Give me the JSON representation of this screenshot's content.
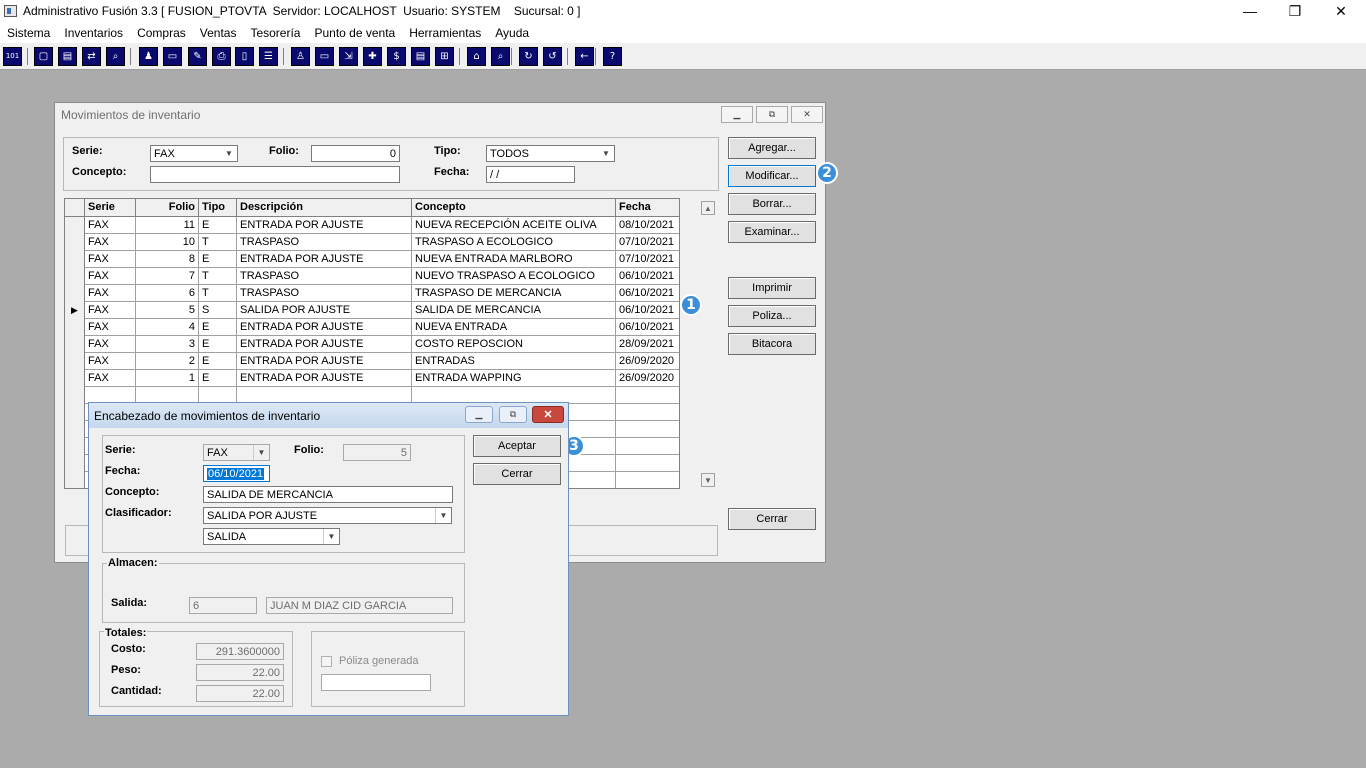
{
  "app": {
    "title": "Administrativo Fusión 3.3 [ FUSION_PTOVTA  Servidor: LOCALHOST  Usuario: SYSTEM    Sucursal: 0 ]",
    "minimize": "—",
    "restore": "❐",
    "close": "✕"
  },
  "menu": [
    "Sistema",
    "Inventarios",
    "Compras",
    "Ventas",
    "Tesorería",
    "Punto de venta",
    "Herramientas",
    "Ayuda"
  ],
  "toolbar": {
    "icons": [
      "calculator-icon",
      "copy-icon",
      "paste-icon",
      "swap-icon",
      "zoom-icon",
      "user-icon",
      "folder-icon",
      "edit-icon",
      "print-icon",
      "document-icon",
      "list-icon",
      "group-icon",
      "window-icon",
      "export-icon",
      "add-icon",
      "dollar-icon",
      "report-icon",
      "tree-icon",
      "home-icon",
      "search-icon",
      "refresh-icon",
      "undo-icon",
      "back-icon",
      "help-icon"
    ],
    "glyphs": [
      "101",
      "▢",
      "▤",
      "⇄",
      "⌕",
      "♟",
      "▭",
      "✎",
      "⎙",
      "▯",
      "☰",
      "♙",
      "▭",
      "⇲",
      "✚",
      "$",
      "▤",
      "⊞",
      "⌂",
      "⌕",
      "↻",
      "↺",
      "←",
      "?"
    ]
  },
  "main": {
    "title": "Movimientos de inventario",
    "filters": {
      "serie_label": "Serie:",
      "serie_value": "FAX",
      "folio_label": "Folio:",
      "folio_value": "0",
      "tipo_label": "Tipo:",
      "tipo_value": "TODOS",
      "concepto_label": "Concepto:",
      "concepto_value": "",
      "fecha_label": "Fecha:",
      "fecha_value": " / /"
    },
    "grid": {
      "headers": [
        "Serie",
        "Folio",
        "Tipo",
        "Descripción",
        "Concepto",
        "Fecha"
      ],
      "rows": [
        [
          "FAX",
          "11",
          "E",
          "ENTRADA POR AJUSTE",
          "NUEVA RECEPCIÓN ACEITE OLIVA",
          "08/10/2021"
        ],
        [
          "FAX",
          "10",
          "T",
          "TRASPASO",
          "TRASPASO A ECOLOGICO",
          "07/10/2021"
        ],
        [
          "FAX",
          "8",
          "E",
          "ENTRADA POR AJUSTE",
          "NUEVA ENTRADA MARLBORO",
          "07/10/2021"
        ],
        [
          "FAX",
          "7",
          "T",
          "TRASPASO",
          "NUEVO TRASPASO A ECOLOGICO",
          "06/10/2021"
        ],
        [
          "FAX",
          "6",
          "T",
          "TRASPASO",
          "TRASPASO DE MERCANCIA",
          "06/10/2021"
        ],
        [
          "FAX",
          "5",
          "S",
          "SALIDA POR AJUSTE",
          "SALIDA DE MERCANCIA",
          "06/10/2021"
        ],
        [
          "FAX",
          "4",
          "E",
          "ENTRADA POR AJUSTE",
          "NUEVA ENTRADA",
          "06/10/2021"
        ],
        [
          "FAX",
          "3",
          "E",
          "ENTRADA POR AJUSTE",
          "COSTO REPOSCION",
          "28/09/2021"
        ],
        [
          "FAX",
          "2",
          "E",
          "ENTRADA POR AJUSTE",
          "ENTRADAS",
          "26/09/2020"
        ],
        [
          "FAX",
          "1",
          "E",
          "ENTRADA POR AJUSTE",
          "ENTRADA WAPPING",
          "26/09/2020"
        ]
      ],
      "selected_marker": "▶"
    },
    "buttons": {
      "agregar": "Agregar...",
      "modificar": "Modificar...",
      "borrar": "Borrar...",
      "examinar": "Examinar...",
      "imprimir": "Imprimir",
      "poliza": "Poliza...",
      "bitacora": "Bitacora",
      "cerrar": "Cerrar"
    }
  },
  "badges": [
    "1",
    "2",
    "3"
  ],
  "dialog": {
    "title": "Encabezado de movimientos de inventario",
    "serie_label": "Serie:",
    "serie_value": "FAX",
    "folio_label": "Folio:",
    "folio_value": "5",
    "fecha_label": "Fecha:",
    "fecha_value": "06/10/2021",
    "concepto_label": "Concepto:",
    "concepto_value": "SALIDA DE MERCANCIA",
    "clasificador_label": "Clasificador:",
    "clasificador_value": "SALIDA POR AJUSTE",
    "subclasificador_value": "SALIDA",
    "almacen_label": "Almacen:",
    "salida_label": "Salida:",
    "salida_code": "6",
    "salida_name": "JUAN M DIAZ CID GARCIA",
    "totales_label": "Totales:",
    "costo_label": "Costo:",
    "costo_value": "291.3600000",
    "peso_label": "Peso:",
    "peso_value": "22.00",
    "cantidad_label": "Cantidad:",
    "cantidad_value": "22.00",
    "poliza_label": "Póliza generada",
    "poliza_value": "",
    "aceptar": "Aceptar",
    "cerrar": "Cerrar"
  }
}
